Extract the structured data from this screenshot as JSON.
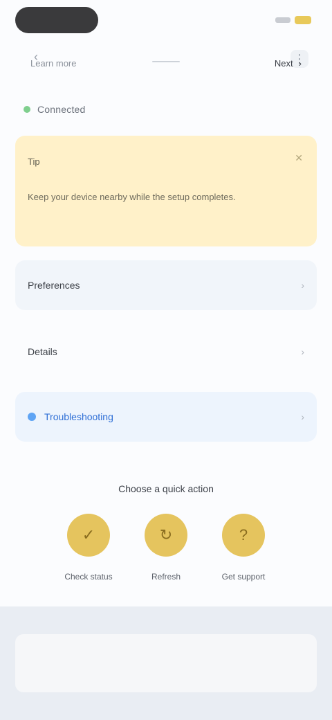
{
  "status_bar": {
    "signal_icon": "signal-icon",
    "battery_icon": "battery-icon"
  },
  "top": {
    "left_icon": "back-icon",
    "right_icon": "more-icon"
  },
  "connection": {
    "label": "Connected"
  },
  "banner": {
    "title": "Tip",
    "text": "Keep your device nearby while the setup completes."
  },
  "rows": [
    {
      "label": "Preferences"
    },
    {
      "label": "Details"
    },
    {
      "label": "Troubleshooting"
    }
  ],
  "cta": {
    "title": "Choose a quick action"
  },
  "actions": [
    {
      "label": "Check status",
      "icon": "check-icon"
    },
    {
      "label": "Refresh",
      "icon": "refresh-icon"
    },
    {
      "label": "Get support",
      "icon": "support-icon"
    }
  ],
  "bottom": {
    "left": "Learn more",
    "right": "Next"
  }
}
